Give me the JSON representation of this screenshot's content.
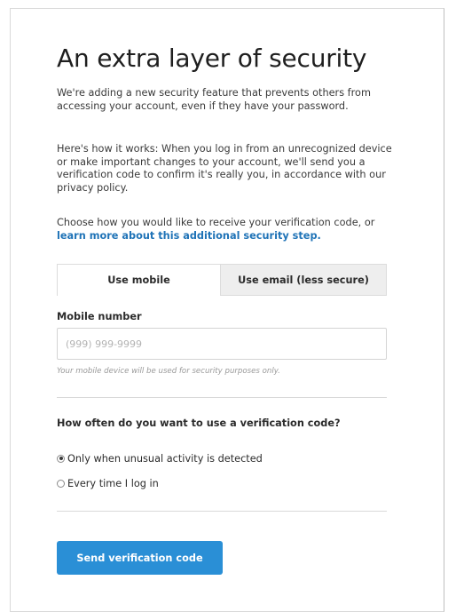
{
  "title": "An extra layer of security",
  "intro": "We're adding a new security feature that prevents others from accessing your account, even if they have your password.",
  "how_it_works": "Here's how it works: When you log in from an unrecognized device or make important changes to your account, we'll send you a verification code to confirm it's really you, in accordance with our privacy policy.",
  "choose": {
    "text": "Choose how you would like to receive your verification code, or ",
    "link": "learn more about this additional security step."
  },
  "tabs": [
    {
      "label": "Use mobile",
      "active": true
    },
    {
      "label": "Use email (less secure)",
      "active": false
    }
  ],
  "mobile": {
    "label": "Mobile number",
    "placeholder": "(999) 999-9999",
    "value": "",
    "hint": "Your mobile device will be used for security purposes only."
  },
  "frequency": {
    "question": "How often do you want to use a verification code?",
    "options": [
      {
        "label": "Only when unusual activity is detected",
        "selected": true
      },
      {
        "label": "Every time I log in",
        "selected": false
      }
    ]
  },
  "send_button": "Send verification code",
  "colors": {
    "accent": "#2a8fd6",
    "link": "#1f73b7",
    "inactive_tab": "#eeeeee"
  }
}
